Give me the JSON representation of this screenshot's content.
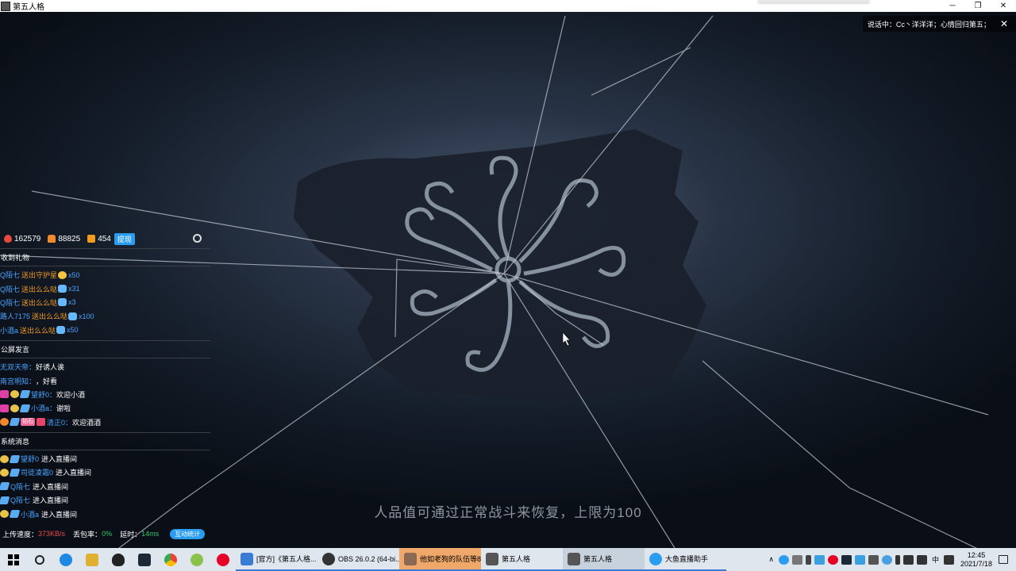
{
  "window": {
    "title": "第五人格",
    "controls": [
      "─",
      "❐",
      "✕"
    ]
  },
  "speaking_banner": {
    "text": "说话中：Cc丶洋洋洋；心情回归第五；",
    "close": "✕"
  },
  "stats": {
    "heat": "162579",
    "followers": "88825",
    "gifts": "454",
    "withdraw_label": "提现",
    "icons": [
      "fire-icon",
      "people-icon",
      "gift-icon",
      "settings-icon"
    ]
  },
  "gifts_section": {
    "title": "收到礼物",
    "items": [
      {
        "user": "Q陌七",
        "action": "送出守护星",
        "count": "x50",
        "gift": "gold"
      },
      {
        "user": "Q陌七",
        "action": "送出么么哒",
        "count": "x31",
        "gift": "blue"
      },
      {
        "user": "Q陌七",
        "action": "送出么么哒",
        "count": "x3",
        "gift": "blue"
      },
      {
        "user": "路人7175",
        "action": "送出么么哒",
        "count": "x100",
        "gift": "blue"
      },
      {
        "user": "小酒a",
        "action": "送出么么哒",
        "count": "x50",
        "gift": "blue"
      }
    ]
  },
  "chat_section": {
    "title": "公屏发言",
    "items": [
      {
        "user": "无双天帝：",
        "msg": "好诱人诶",
        "badges": []
      },
      {
        "user": "南宫明知：",
        "msg": "，好看",
        "badges": []
      },
      {
        "user": "望舒0：",
        "msg": "欢迎小酒",
        "badges": [
          "pink",
          "gold",
          "blue"
        ]
      },
      {
        "user": "小酒a：",
        "msg": "谢啦",
        "badges": [
          "pink",
          "gold",
          "blue"
        ]
      },
      {
        "user": "清正0：",
        "msg": "欢迎酒酒",
        "badges": [
          "orange",
          "blue",
          "tag",
          "red"
        ]
      }
    ],
    "tag_text": "钻石"
  },
  "system_section": {
    "title": "系统消息",
    "items": [
      {
        "user": "望舒0",
        "action": "进入直播间",
        "badges": [
          "gold",
          "blue"
        ]
      },
      {
        "user": "司徒凌霜0",
        "action": "进入直播间",
        "badges": [
          "gold",
          "blue"
        ]
      },
      {
        "user": "Q陌七",
        "action": "进入直播间",
        "badges": [
          "blue"
        ]
      },
      {
        "user": "Q陌七",
        "action": "进入直播间",
        "badges": [
          "blue"
        ]
      },
      {
        "user": "小酒a",
        "action": "进入直播间",
        "badges": [
          "gold",
          "blue"
        ]
      }
    ]
  },
  "footer": {
    "upload_label": "上传速度：",
    "upload_value": "373KB/s",
    "loss_label": "丢包率：",
    "loss_value": "0%",
    "latency_label": "延时：",
    "latency_value": "14ms",
    "button": "互动统计"
  },
  "game": {
    "hint": "人品值可通过正常战斗来恢复，上限为100"
  },
  "taskbar": {
    "tasks": [
      {
        "label": "[官方]《第五人格...",
        "icon_color": "#3a7bd5",
        "state": "normal"
      },
      {
        "label": "OBS 26.0.2 (64-bi...",
        "icon_color": "#333333",
        "state": "normal"
      },
      {
        "label": "他如老狗的队伍等8...",
        "icon_color": "#8a6a55",
        "state": "active"
      },
      {
        "label": "第五人格",
        "icon_color": "#555555",
        "state": "normal"
      },
      {
        "label": "第五人格",
        "icon_color": "#555555",
        "state": "sel"
      },
      {
        "label": "大鱼直播助手",
        "icon_color": "#2b9df0",
        "state": "normal"
      }
    ],
    "tray": {
      "chevron": "∧",
      "ime": "中",
      "time": "12:45",
      "date": "2021/7/18"
    }
  }
}
